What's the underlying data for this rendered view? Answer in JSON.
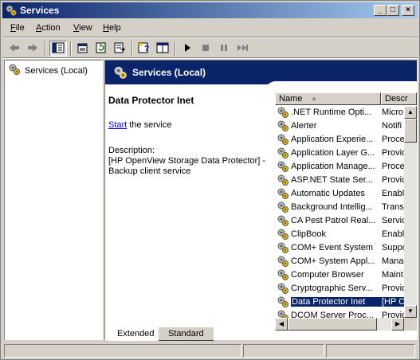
{
  "window": {
    "title": "Services",
    "controls": {
      "minimize": "_",
      "maximize": "□",
      "close": "×"
    }
  },
  "menu": {
    "items": [
      {
        "label": "File",
        "accel": "F",
        "rest": "ile"
      },
      {
        "label": "Action",
        "accel": "A",
        "rest": "ction"
      },
      {
        "label": "View",
        "accel": "V",
        "rest": "iew"
      },
      {
        "label": "Help",
        "accel": "H",
        "rest": "elp"
      }
    ]
  },
  "toolbar": {
    "buttons": [
      "back-icon",
      "forward-icon",
      "show-hide-tree-icon",
      "properties-icon",
      "refresh-icon",
      "export-list-icon",
      "help-icon",
      "console-tree-icon",
      "play-icon",
      "stop-icon",
      "pause-icon",
      "restart-icon"
    ]
  },
  "tree": {
    "root_label": "Services (Local)"
  },
  "banner": {
    "title": "Services (Local)"
  },
  "details": {
    "service_name": "Data Protector Inet",
    "start_link": "Start",
    "start_rest": " the service",
    "description_label": "Description:",
    "description_text": "[HP OpenView Storage Data Protector] - Backup client service"
  },
  "list": {
    "columns": [
      {
        "label": "Name",
        "sort_glyph": "▲"
      },
      {
        "label": "Descr"
      }
    ],
    "rows": [
      {
        "name": ".NET Runtime Opti...",
        "desc": "Micro"
      },
      {
        "name": "Alerter",
        "desc": "Notifi"
      },
      {
        "name": "Application Experie...",
        "desc": "Proce"
      },
      {
        "name": "Application Layer G...",
        "desc": "Provid"
      },
      {
        "name": "Application Manage...",
        "desc": "Proce"
      },
      {
        "name": "ASP.NET State Ser...",
        "desc": "Provid"
      },
      {
        "name": "Automatic Updates",
        "desc": "Enabl"
      },
      {
        "name": "Background Intellig...",
        "desc": "Trans"
      },
      {
        "name": "CA Pest Patrol Real...",
        "desc": "Servic"
      },
      {
        "name": "ClipBook",
        "desc": "Enabl"
      },
      {
        "name": "COM+ Event System",
        "desc": "Suppo"
      },
      {
        "name": "COM+ System Appl...",
        "desc": "Mana"
      },
      {
        "name": "Computer Browser",
        "desc": "Maint"
      },
      {
        "name": "Cryptographic Serv...",
        "desc": "Provid"
      },
      {
        "name": "Data Protector Inet",
        "desc": "[HP C"
      },
      {
        "name": "DCOM Server Proc...",
        "desc": "Provid"
      }
    ],
    "selected_index": 14
  },
  "tabs": [
    {
      "label": "Extended"
    },
    {
      "label": "Standard"
    }
  ],
  "colors": {
    "title_start": "#0a246a",
    "title_end": "#a6caf0",
    "selection": "#0a246a",
    "link": "#0000ee",
    "chrome": "#d4d0c8"
  }
}
